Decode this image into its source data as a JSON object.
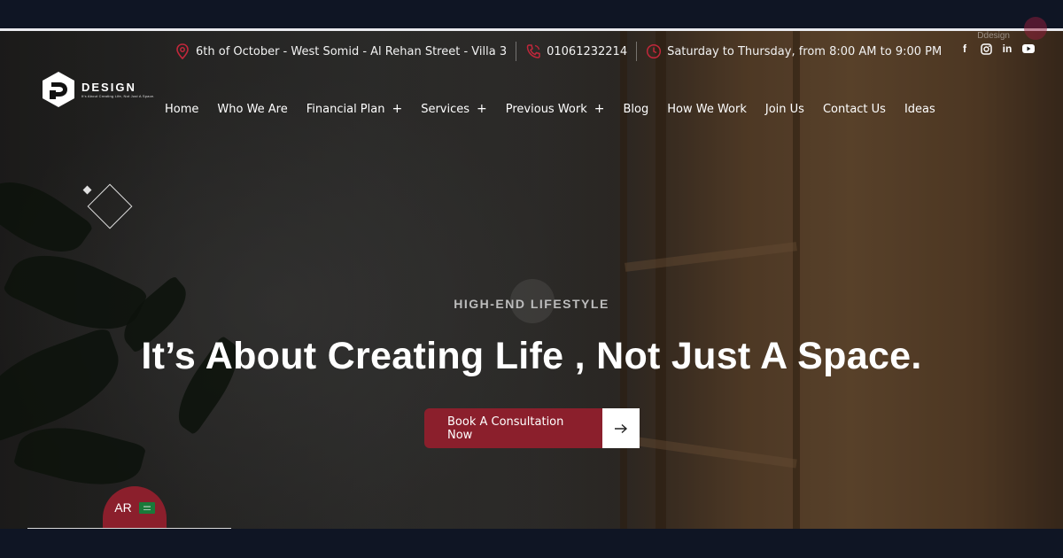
{
  "topbar": {
    "address": "6th of October - West Somid - Al Rehan Street - Villa 3",
    "phone": "01061232214",
    "hours": "Saturday to Thursday, from 8:00 AM to 9:00 PM",
    "ghost_label": "Ddesign",
    "icons": [
      "location-pin-icon",
      "phone-icon",
      "clock-icon"
    ]
  },
  "social": {
    "facebook": "f",
    "instagram": "◎",
    "linkedin": "in",
    "youtube": "▶"
  },
  "logo": {
    "word": "DESIGN",
    "tagline": "It's About Creating Life, Not Just A Space."
  },
  "nav": {
    "items": [
      {
        "label": "Home"
      },
      {
        "label": "Who We Are"
      },
      {
        "label": "Financial Plan",
        "plus": "+"
      },
      {
        "label": "Services",
        "plus": "+"
      },
      {
        "label": "Previous Work",
        "plus": "+"
      },
      {
        "label": "Blog"
      },
      {
        "label": "How We Work"
      },
      {
        "label": "Join Us"
      },
      {
        "label": "Contact Us"
      },
      {
        "label": "Ideas"
      }
    ]
  },
  "hero": {
    "eyebrow": "HIGH-END LIFESTYLE",
    "headline": "It’s About Creating Life , Not Just A Space.",
    "cta_label": "Book A Consultation Now"
  },
  "language": {
    "label": "AR",
    "flag_text": "ﷲ"
  },
  "colors": {
    "accent": "#8b1f2c",
    "frame": "#0f1524"
  }
}
